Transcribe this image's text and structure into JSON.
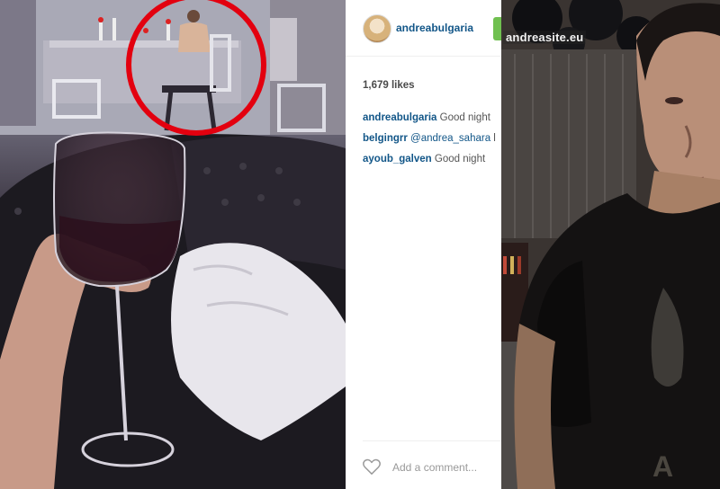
{
  "post": {
    "username": "andreabulgaria",
    "likes": "1,679 likes",
    "comments": [
      {
        "user": "andreabulgaria",
        "text": "Good night"
      },
      {
        "user": "belgingrr",
        "mention": "@andrea_sahara",
        "text": "l"
      },
      {
        "user": "ayoub_galven",
        "text": "Good night"
      }
    ],
    "add_comment_placeholder": "Add a comment..."
  },
  "right_photo": {
    "watermark": "andreasite.eu"
  },
  "colors": {
    "username": "#125688",
    "follow_button": "#70c050",
    "highlight_circle": "#e3000f"
  },
  "icons": {
    "like": "heart-outline-icon"
  }
}
